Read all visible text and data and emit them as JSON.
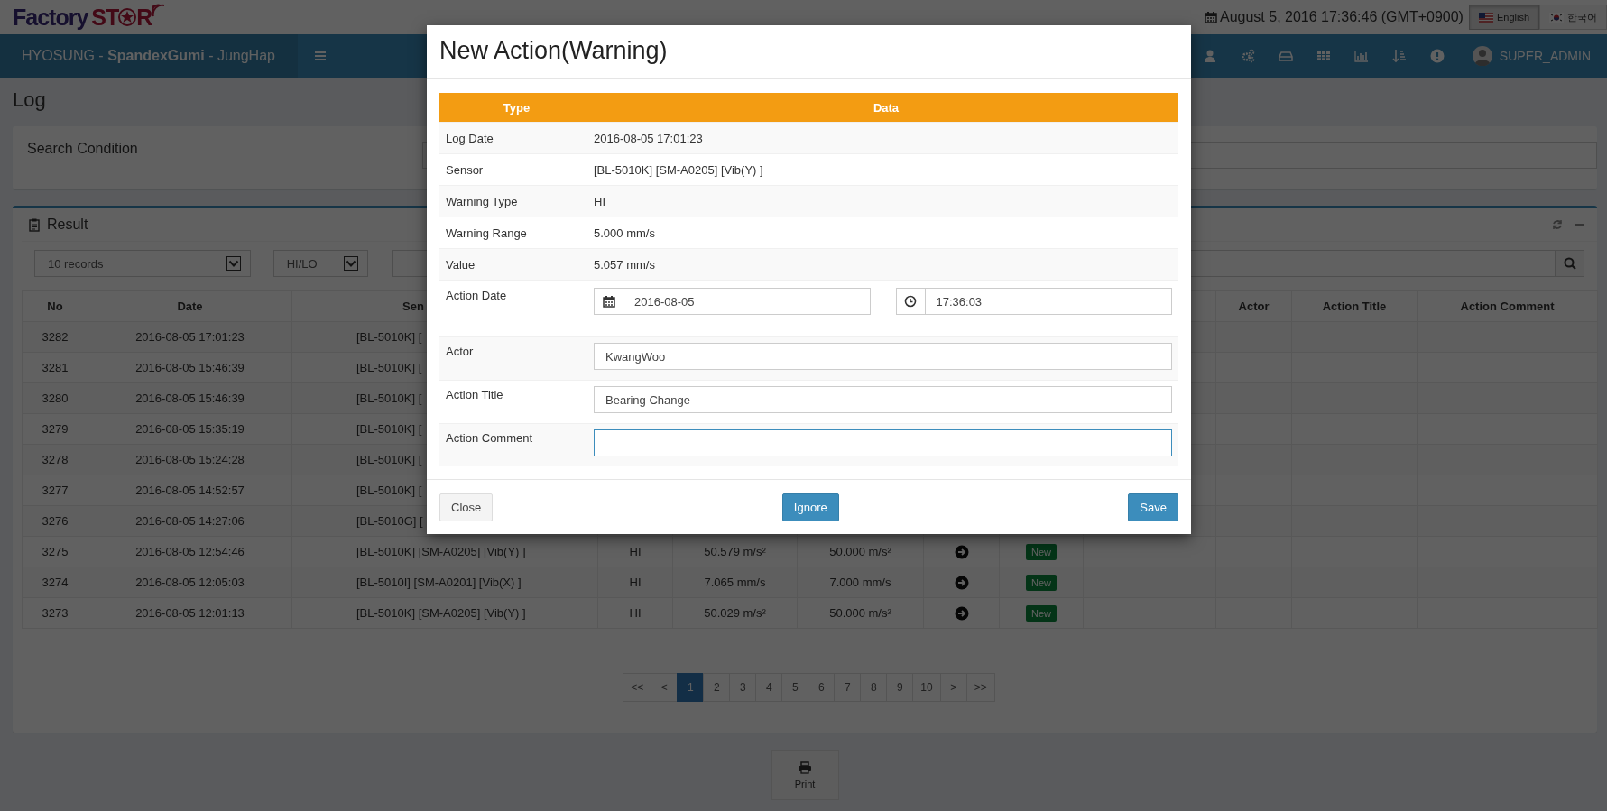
{
  "logo": {
    "first": "Factory",
    "second_start": "ST",
    "second_end": "R"
  },
  "datetime": "August 5, 2016 17:36:46 (GMT+0900)",
  "languages": [
    {
      "label": "English",
      "selected": true
    },
    {
      "label": "한국어",
      "selected": false
    }
  ],
  "nav": {
    "brand": "HYOSUNG - **SpandexGumi** - JungHap",
    "user": "SUPER_ADMIN"
  },
  "page_title": "Log",
  "search_panel": {
    "title": "Search Condition"
  },
  "result_panel": {
    "title": "Result",
    "records_select": "10 records",
    "type_select": "HI/LO"
  },
  "table": {
    "columns": [
      "No",
      "Date",
      "Sen"
    ],
    "right_columns": [
      "Actor",
      "Action Title",
      "Action Comment"
    ],
    "rows": [
      {
        "no": "3282",
        "date": "2016-08-05 17:01:23",
        "sensor": "[BL-5010K] ["
      },
      {
        "no": "3281",
        "date": "2016-08-05 15:46:39",
        "sensor": "[BL-5010K] ["
      },
      {
        "no": "3280",
        "date": "2016-08-05 15:46:39",
        "sensor": "[BL-5010K] ["
      },
      {
        "no": "3279",
        "date": "2016-08-05 15:35:19",
        "sensor": "[BL-5010K] ["
      },
      {
        "no": "3278",
        "date": "2016-08-05 15:24:28",
        "sensor": "[BL-5010K] ["
      },
      {
        "no": "3277",
        "date": "2016-08-05 14:52:57",
        "sensor": "[BL-5010K] ["
      },
      {
        "no": "3276",
        "date": "2016-08-05 14:27:06",
        "sensor": "[BL-5010G] ["
      },
      {
        "no": "3275",
        "date": "2016-08-05 12:54:46",
        "sensor": "[BL-5010K] [SM-A0205] [Vib(Y) ]",
        "warning_type": "HI",
        "value": "50.579 m/s²",
        "range": "50.000 m/s²",
        "status": "New"
      },
      {
        "no": "3274",
        "date": "2016-08-05 12:05:03",
        "sensor": "[BL-5010I] [SM-A0201] [Vib(X) ]",
        "warning_type": "HI",
        "value": "7.065 mm/s",
        "range": "7.000 mm/s",
        "status": "New"
      },
      {
        "no": "3273",
        "date": "2016-08-05 12:01:13",
        "sensor": "[BL-5010K] [SM-A0205] [Vib(Y) ]",
        "warning_type": "HI",
        "value": "50.029 m/s²",
        "range": "50.000 m/s²",
        "status": "New"
      }
    ]
  },
  "pagination": [
    {
      "label": "<<",
      "selected": false
    },
    {
      "label": "<",
      "selected": false
    },
    {
      "label": "1",
      "selected": true
    },
    {
      "label": "2",
      "selected": false
    },
    {
      "label": "3",
      "selected": false
    },
    {
      "label": "4",
      "selected": false
    },
    {
      "label": "5",
      "selected": false
    },
    {
      "label": "6",
      "selected": false
    },
    {
      "label": "7",
      "selected": false
    },
    {
      "label": "8",
      "selected": false
    },
    {
      "label": "9",
      "selected": false
    },
    {
      "label": "10",
      "selected": false
    },
    {
      "label": ">",
      "selected": false
    },
    {
      "label": ">>",
      "selected": false
    }
  ],
  "print_button": "Print",
  "modal": {
    "title": "New Action(Warning)",
    "columns": [
      "Type",
      "Data"
    ],
    "info_rows": [
      {
        "label": "Log Date",
        "value": "2016-08-05 17:01:23"
      },
      {
        "label": "Sensor",
        "value": "[BL-5010K] [SM-A0205] [Vib(Y) ]"
      },
      {
        "label": "Warning Type",
        "value": "HI"
      },
      {
        "label": "Warning Range",
        "value": "5.000 mm/s"
      },
      {
        "label": "Value",
        "value": "5.057 mm/s"
      }
    ],
    "action_date": {
      "label": "Action Date",
      "date": "2016-08-05",
      "time": "17:36:03"
    },
    "fields": [
      {
        "label": "Actor",
        "value": "KwangWoo",
        "focused": false
      },
      {
        "label": "Action Title",
        "value": "Bearing Change",
        "focused": false
      },
      {
        "label": "Action Comment",
        "focused": true
      }
    ],
    "buttons": [
      {
        "label": "Close",
        "kind": "default"
      },
      {
        "label": "Ignore",
        "kind": "primary"
      },
      {
        "label": "Save",
        "kind": "primary"
      }
    ]
  }
}
